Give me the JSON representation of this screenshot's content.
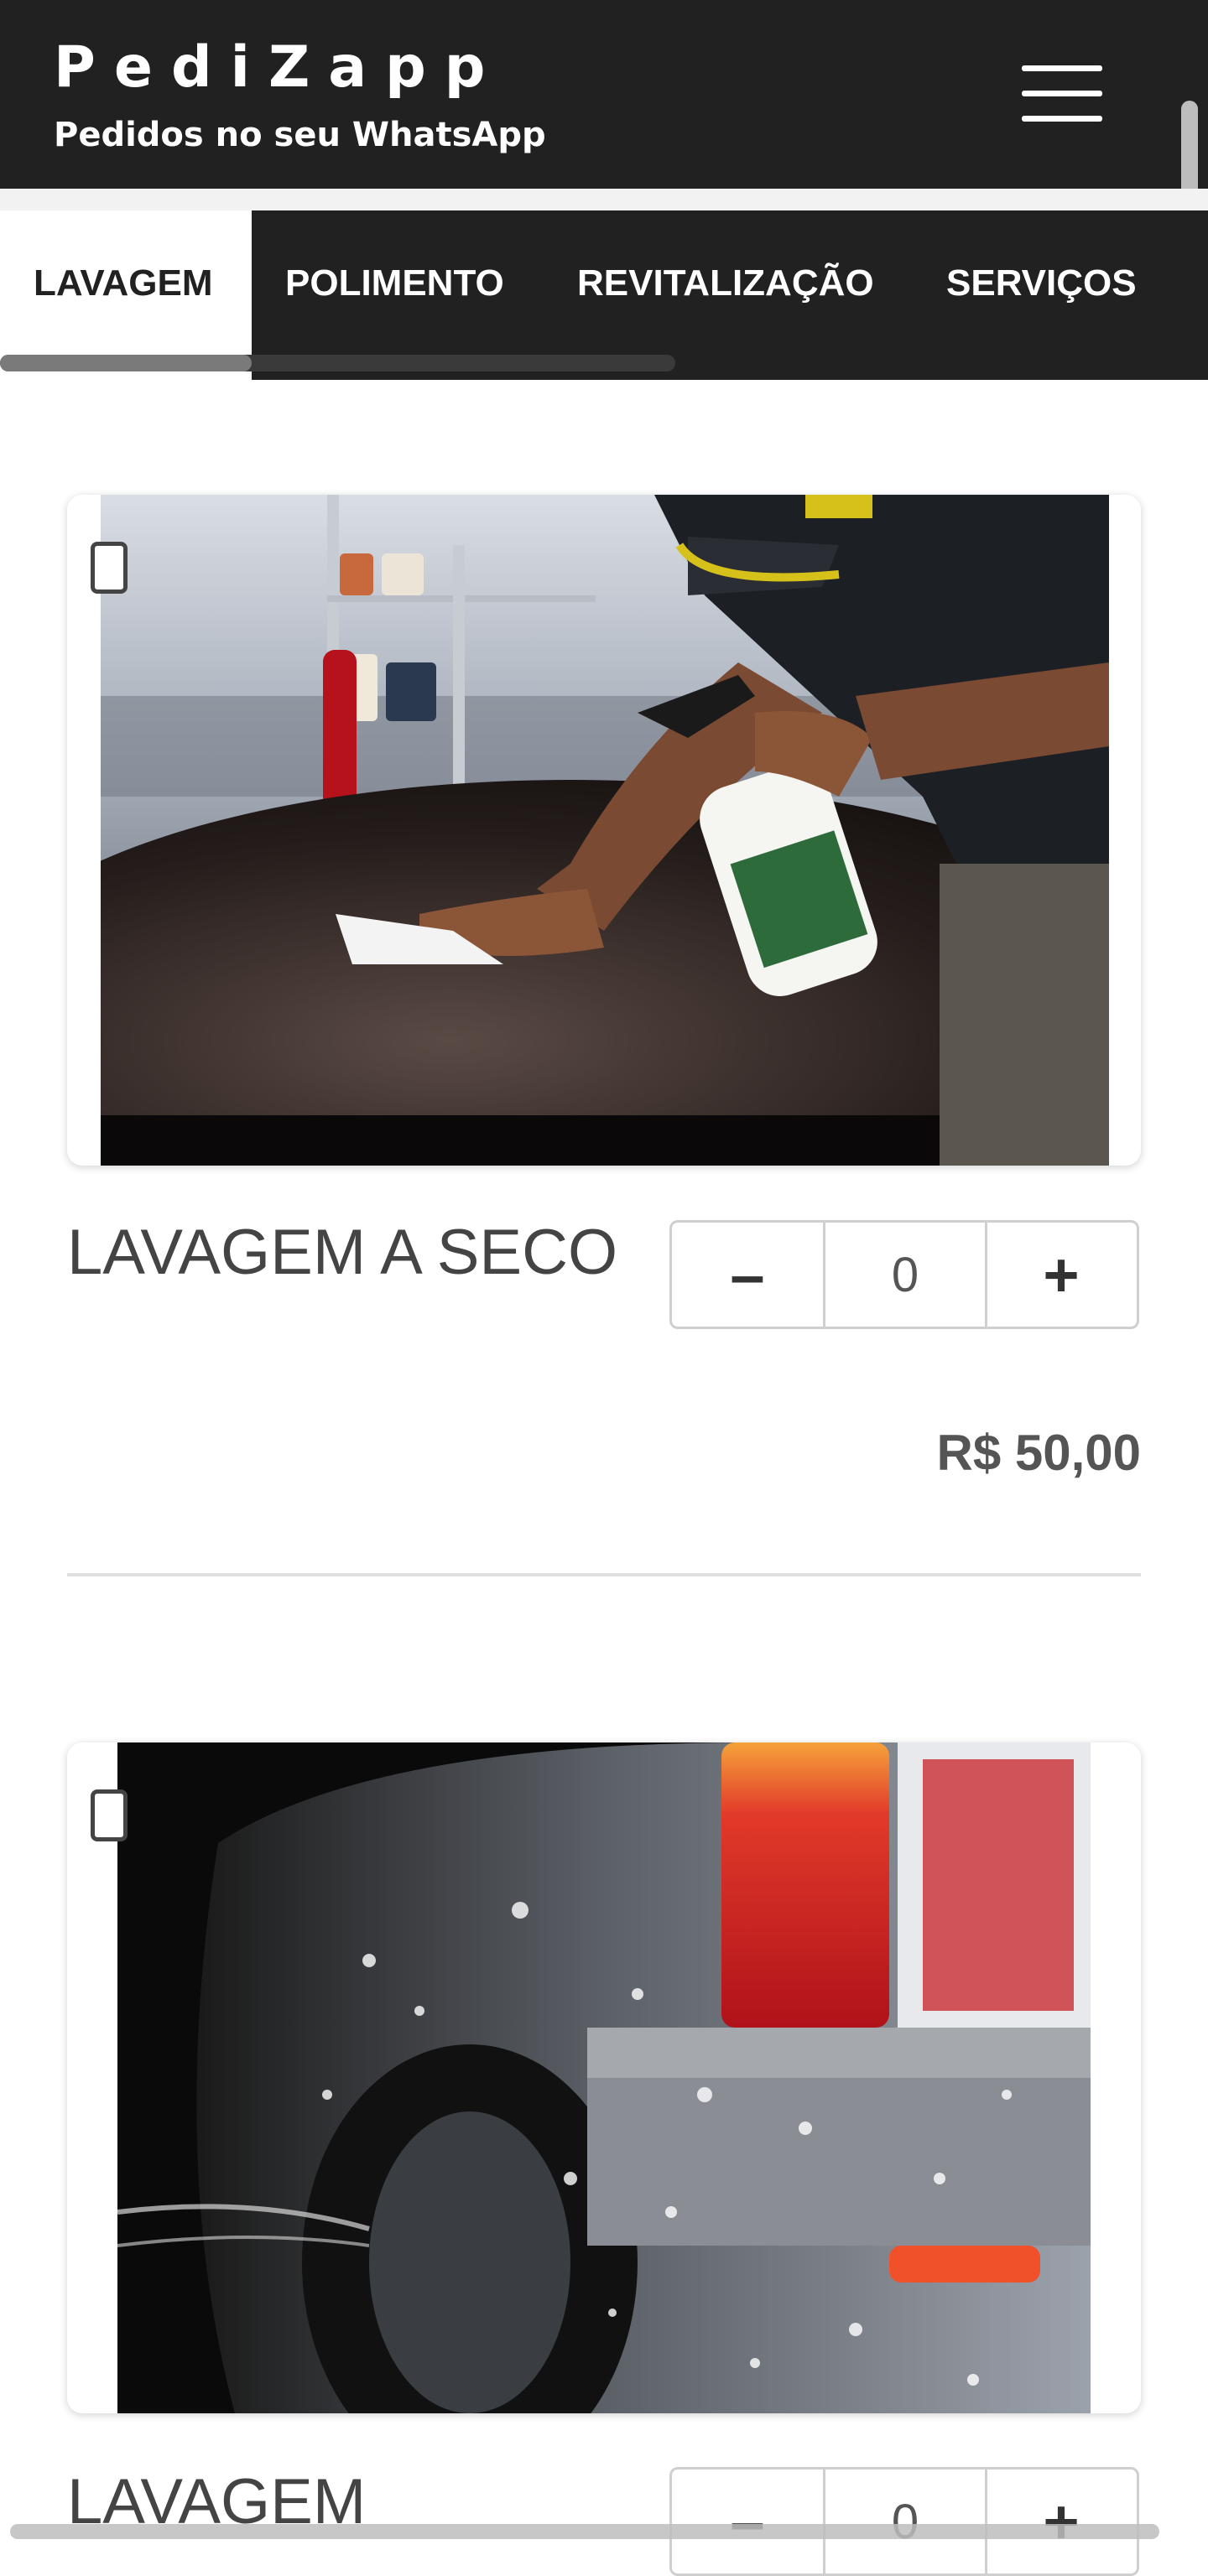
{
  "header": {
    "brand": "PediZapp",
    "tagline": "Pedidos no seu WhatsApp"
  },
  "tabs": [
    {
      "label": "LAVAGEM",
      "active": true
    },
    {
      "label": "POLIMENTO",
      "active": false
    },
    {
      "label": "REVITALIZAÇÃO",
      "active": false
    },
    {
      "label": "SERVIÇOS",
      "active": false
    }
  ],
  "products": [
    {
      "name": "LAVAGEM A SECO",
      "quantity": "0",
      "price": "R$ 50,00",
      "minus": "–",
      "plus": "+"
    },
    {
      "name": "LAVAGEM",
      "quantity": "0",
      "minus": "–",
      "plus": "+"
    }
  ],
  "colors": {
    "header_bg": "#212121",
    "text_dark": "#444444"
  }
}
